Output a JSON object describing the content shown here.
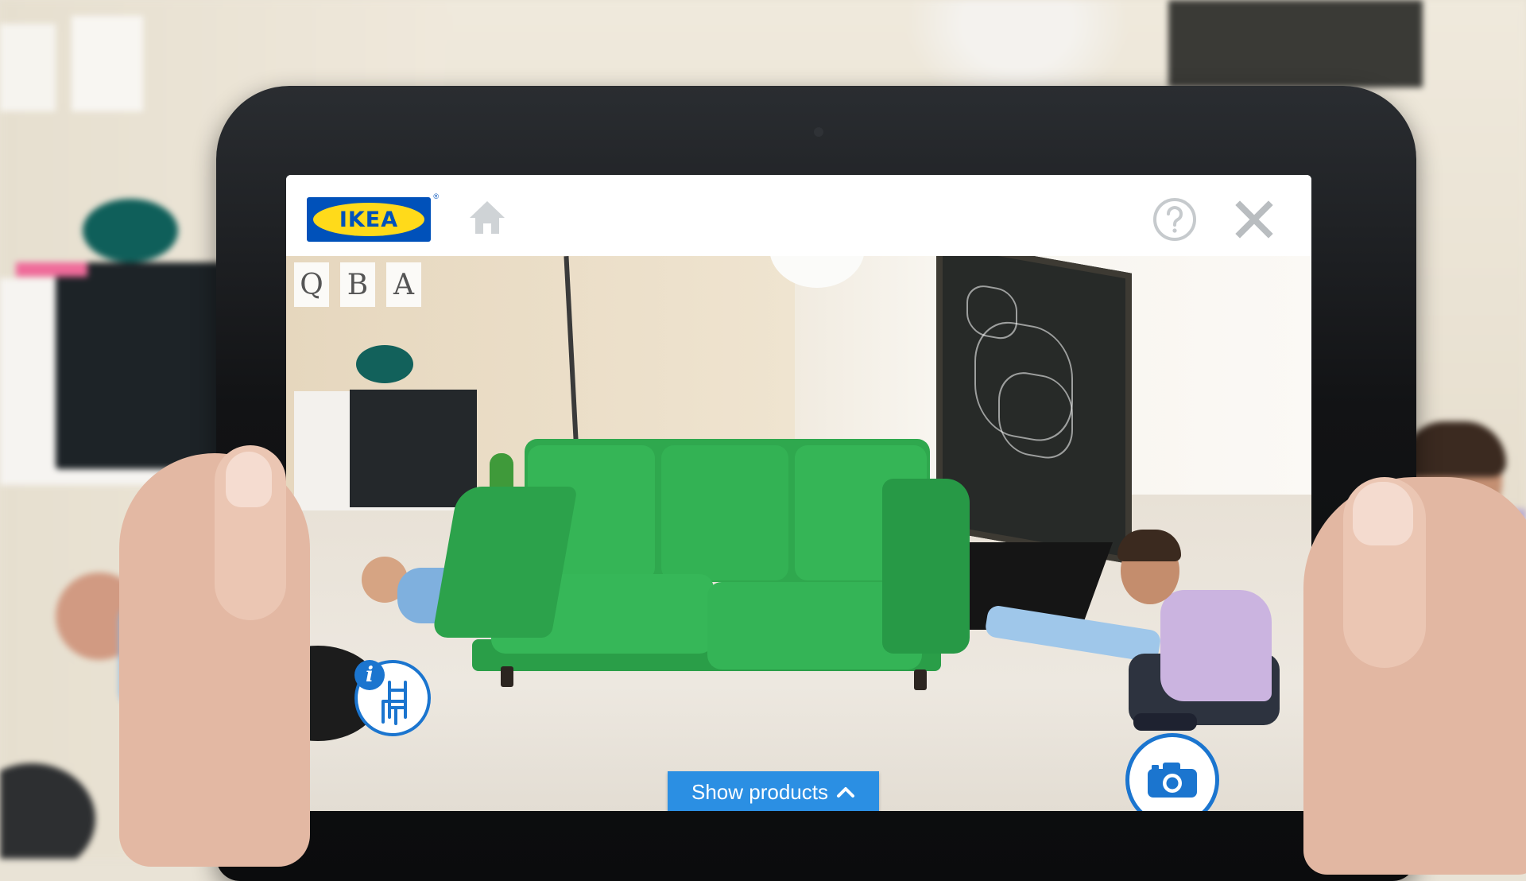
{
  "app": {
    "logo_text": "IKEA",
    "logo_reg": "®",
    "colors": {
      "brand_blue": "#0051ba",
      "brand_yellow": "#ffda1a",
      "ui_blue": "#2b8fe3",
      "sofa_green": "#33b254"
    }
  },
  "header": {
    "home_icon": "home-icon",
    "help_icon": "help-icon",
    "close_icon": "close-icon"
  },
  "scene": {
    "wall_letters": [
      "Q",
      "B",
      "A"
    ]
  },
  "controls": {
    "product_info_icon": "chair-info-icon",
    "info_glyph": "i",
    "show_products_label": "Show products",
    "show_products_icon": "chevron-up-icon",
    "camera_icon": "camera-icon"
  }
}
